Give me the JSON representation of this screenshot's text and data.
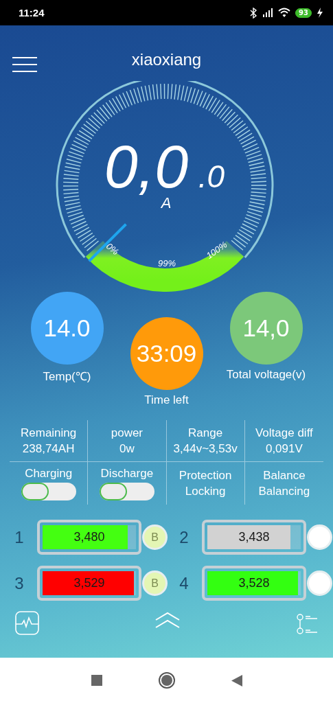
{
  "status_bar": {
    "time": "11:24",
    "battery": "93"
  },
  "header": {
    "title": "xiaoxiang"
  },
  "gauge": {
    "value": "0,0",
    "decimal": ".0",
    "unit": "A",
    "labels": [
      "0%",
      "99%",
      "100%"
    ]
  },
  "indicators": [
    {
      "value": "14.0",
      "label": "Temp(℃)",
      "color": "#42a5f5"
    },
    {
      "value": "33:09",
      "label": "Time left",
      "color": "#ff9a0a"
    },
    {
      "value": "14,0",
      "label": "Total voltage(v)",
      "color": "#7cc87a"
    }
  ],
  "stats": [
    {
      "kind": "text",
      "label": "Remaining",
      "value": "238,74AH"
    },
    {
      "kind": "text",
      "label": "power",
      "value": "0w"
    },
    {
      "kind": "text",
      "label": "Range",
      "value": "3,44v~3,53v"
    },
    {
      "kind": "text",
      "label": "Voltage diff",
      "value": "0,091V"
    },
    {
      "kind": "toggle",
      "label": "Charging",
      "on": false
    },
    {
      "kind": "toggle",
      "label": "Discharge",
      "on": false
    },
    {
      "kind": "text",
      "label": "Protection",
      "value": "Locking"
    },
    {
      "kind": "text",
      "label": "Balance",
      "value": "Balancing"
    }
  ],
  "cells": [
    {
      "number": "1",
      "value": "3,480",
      "color": "#44ff11",
      "level": 0.91,
      "balancing": true,
      "badge": "B"
    },
    {
      "number": "2",
      "value": "3,438",
      "color": "#d2d2d2",
      "level": 0.89,
      "balancing": false
    },
    {
      "number": "3",
      "value": "3,529",
      "color": "#ff0000",
      "level": 0.98,
      "balancing": true,
      "badge": "B"
    },
    {
      "number": "4",
      "value": "3,528",
      "color": "#33ff11",
      "level": 0.97,
      "balancing": false
    }
  ]
}
